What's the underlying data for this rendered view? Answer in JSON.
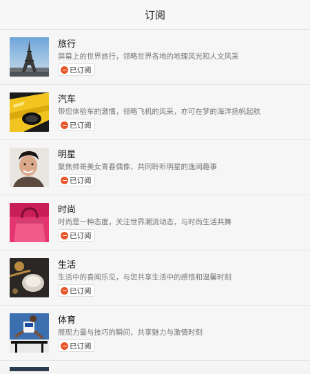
{
  "header": {
    "title": "订阅"
  },
  "subscribed_label": "已订阅",
  "items": [
    {
      "title": "旅行",
      "desc": "屏幕上的世界旅行，领略世界各地的地理风光和人文风采",
      "thumb": "eiffel-tower-photo"
    },
    {
      "title": "汽车",
      "desc": "带您体验车的激情，领略飞机的风采，亦可在梦的海洋扬帆起航",
      "thumb": "yellow-car-photo"
    },
    {
      "title": "明星",
      "desc": "聚焦帅哥美女青春偶像，共同聆听明星的逸闻趣事",
      "thumb": "smiling-man-photo"
    },
    {
      "title": "时尚",
      "desc": "时尚是一种态度，关注世界潮流动态，与时尚生活共舞",
      "thumb": "pink-handbag-photo"
    },
    {
      "title": "生活",
      "desc": "生活中的喜闻乐见，与您共享生活中的感悟和温馨时刻",
      "thumb": "tea-bowl-photo"
    },
    {
      "title": "体育",
      "desc": "展现力量与技巧的瞬间，共享魅力与激情时刻",
      "thumb": "hurdle-runner-photo"
    }
  ]
}
